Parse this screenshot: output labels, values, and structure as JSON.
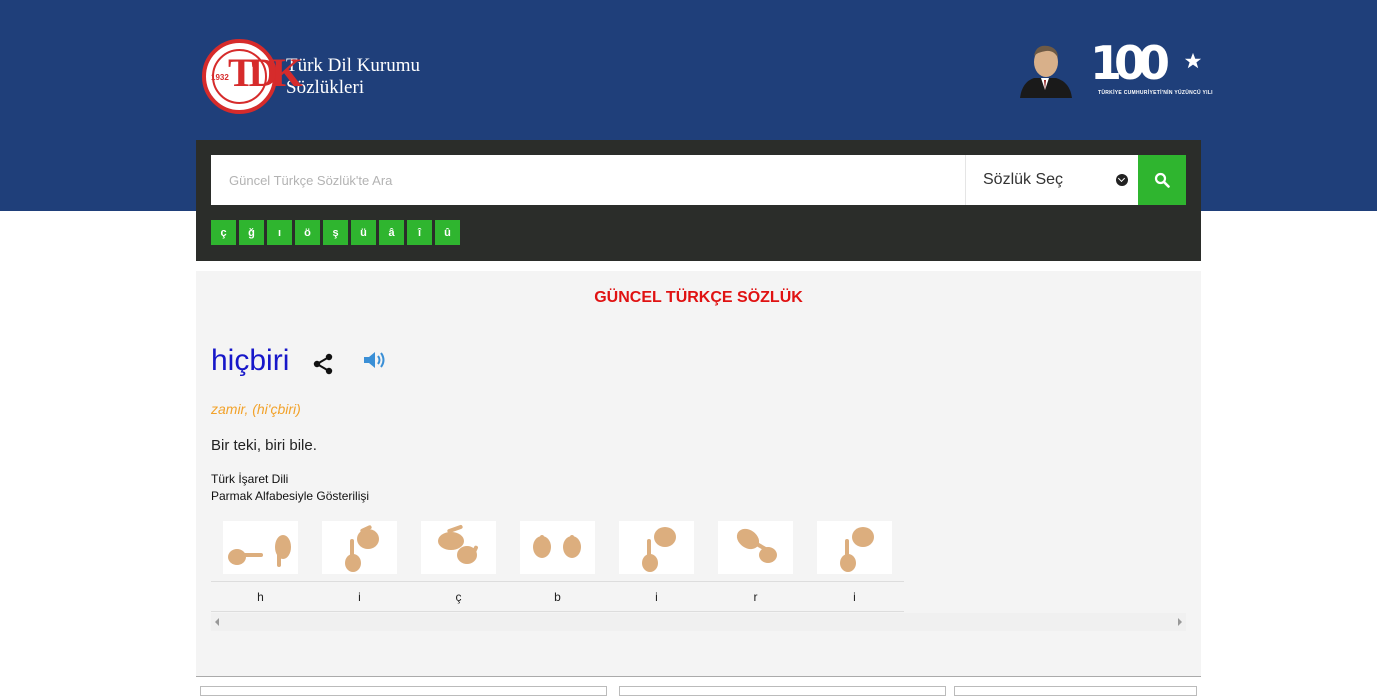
{
  "header": {
    "logo_year": "1932",
    "logo_mark": "TDK",
    "logo_line1": "Türk Dil Kurumu",
    "logo_line2": "Sözlükleri",
    "centennial_number": "100",
    "centennial_caption": "TÜRKİYE CUMHURİYETİ'NİN YÜZÜNCÜ YILI"
  },
  "search": {
    "placeholder": "Güncel Türkçe Sözlük'te Ara",
    "value": "",
    "dictionary_select_label": "Sözlük Seç",
    "special_chars": [
      "ç",
      "ğ",
      "ı",
      "ö",
      "ş",
      "ü",
      "â",
      "î",
      "û"
    ]
  },
  "result": {
    "dictionary_title": "GÜNCEL TÜRKÇE SÖZLÜK",
    "headword": "hiçbiri",
    "pos_pronunciation": "zamir, (hi'çbiri)",
    "meaning": "Bir teki, biri bile.",
    "sign_label_line1": "Türk İşaret Dili",
    "sign_label_line2": "Parmak Alfabesiyle Gösterilişi",
    "letters": [
      "h",
      "i",
      "ç",
      "b",
      "i",
      "r",
      "i"
    ]
  },
  "colors": {
    "header_bg": "#1f3f7a",
    "search_panel_bg": "#2b2d2a",
    "accent_green": "#2fb52f",
    "title_red": "#e01212",
    "headword_blue": "#1717c9",
    "pos_orange": "#f2a22a"
  },
  "icons": [
    "search-icon",
    "chevron-down-icon",
    "share-icon",
    "speaker-icon"
  ]
}
